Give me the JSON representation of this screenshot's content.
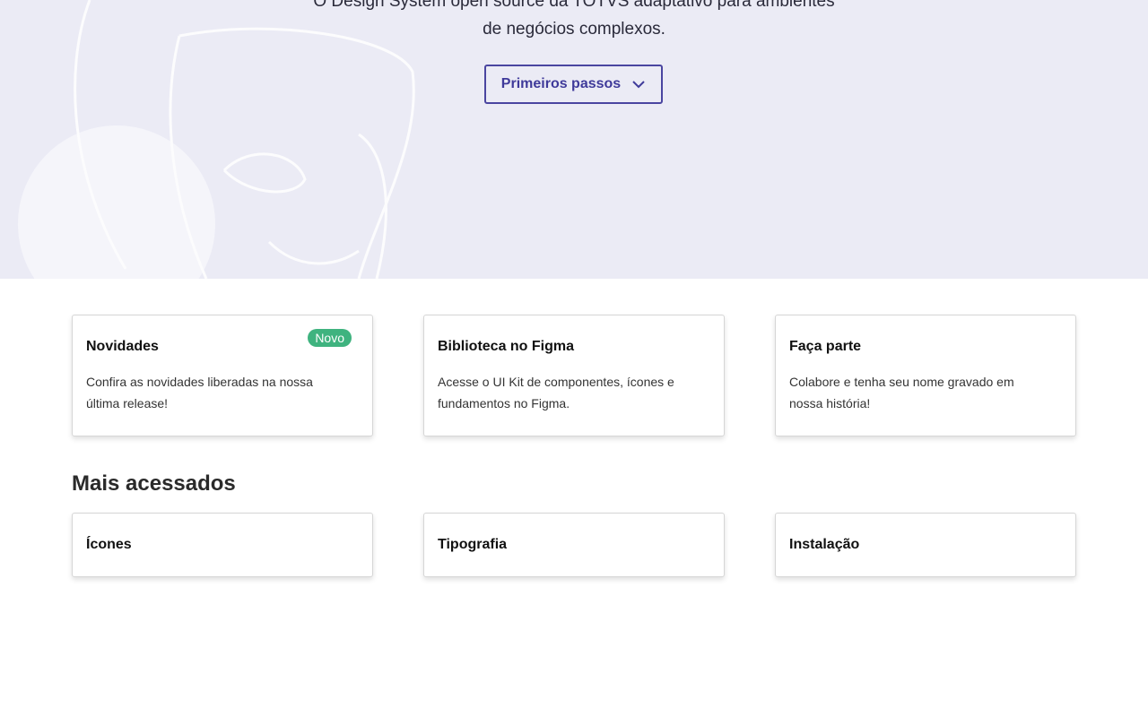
{
  "hero": {
    "subtitle_line1": "O Design System open source da TOTVS adaptativo para ambientes",
    "subtitle_line2": "de negócios complexos.",
    "button_label": "Primeiros passos",
    "button_icon": "chevron-down-icon"
  },
  "cards": [
    {
      "title": "Novidades",
      "description": "Confira as novidades liberadas na nossa última release!",
      "badge": "Novo"
    },
    {
      "title": "Biblioteca no Figma",
      "description": "Acesse o UI Kit de componentes, ícones e fundamentos no Figma."
    },
    {
      "title": "Faça parte",
      "description": "Colabore e tenha seu nome gravado em nossa história!"
    }
  ],
  "most_accessed": {
    "title": "Mais acessados",
    "items": [
      {
        "title": "Ícones"
      },
      {
        "title": "Tipografia"
      },
      {
        "title": "Instalação"
      }
    ]
  },
  "colors": {
    "accent": "#3f3a9a",
    "badge": "#3fb37f",
    "hero_bg": "#ebebf5"
  }
}
